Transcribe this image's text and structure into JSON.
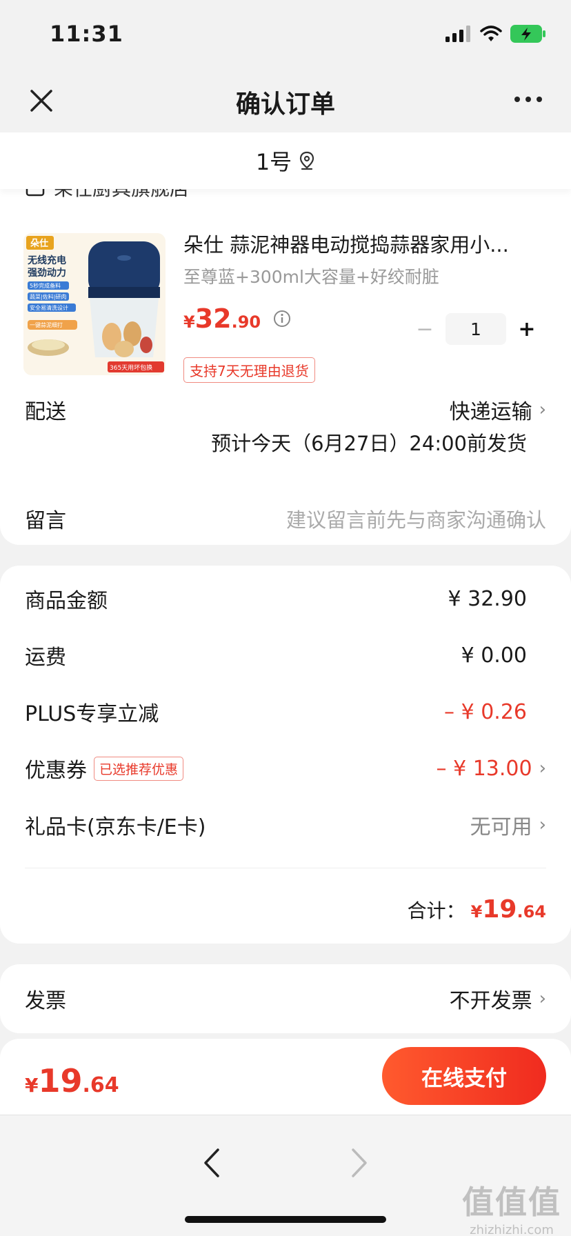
{
  "status": {
    "time": "11:31"
  },
  "nav": {
    "title": "确认订单"
  },
  "address": {
    "text": "1号"
  },
  "store": {
    "name": "朵仕厨具旗舰店"
  },
  "product": {
    "title": "朵仕 蒜泥神器电动搅捣蒜器家用小...",
    "spec": "至尊蓝+300ml大容量+好绞耐脏",
    "price_yen": "¥",
    "price_int": "32",
    "price_dec": ".90",
    "quantity": "1",
    "qty_minus": "−",
    "qty_plus": "+",
    "return_tag": "支持7天无理由退货",
    "image_texts": {
      "brand": "朵仕",
      "line1": "无线充电",
      "line2": "强劲动力",
      "badge1": "5秒完成备料",
      "badge2": "蔬菜|佐料|研肉",
      "badge3": "安全易清洗设计",
      "badge4": "一键蒜泥细打",
      "guarantee": "365天用坏包换"
    }
  },
  "shipping": {
    "label": "配送",
    "method": "快递运输",
    "estimate": "预计今天（6月27日）24:00前发货"
  },
  "message": {
    "label": "留言",
    "placeholder": "建议留言前先与商家沟通确认"
  },
  "summary": {
    "goods_label": "商品金额",
    "goods_value": "¥ 32.90",
    "freight_label": "运费",
    "freight_value": "¥ 0.00",
    "plus_label": "PLUS专享立减",
    "plus_value": "– ¥ 0.26",
    "coupon_label": "优惠券",
    "coupon_badge": "已选推荐优惠",
    "coupon_value": "– ¥ 13.00",
    "giftcard_label": "礼品卡(京东卡/E卡)",
    "giftcard_value": "无可用",
    "total_label": "合计：",
    "total_yen": "¥",
    "total_int": "19",
    "total_dec": ".64"
  },
  "invoice": {
    "label": "发票",
    "value": "不开发票"
  },
  "bottom": {
    "price_yen": "¥",
    "price_int": "19",
    "price_dec": ".64",
    "pay_label": "在线支付"
  },
  "watermark": {
    "big": "值值值",
    "small": "zhizhizhi.com"
  },
  "colors": {
    "accent": "#e8392a",
    "pay_start": "#ff5a2e",
    "pay_end": "#f02b1f",
    "battery": "#34c759"
  },
  "icons": [
    "close-icon",
    "more-icon",
    "location-pin-icon",
    "store-icon",
    "info-icon",
    "chevron-right-icon",
    "back-arrow-icon",
    "forward-arrow-icon"
  ]
}
